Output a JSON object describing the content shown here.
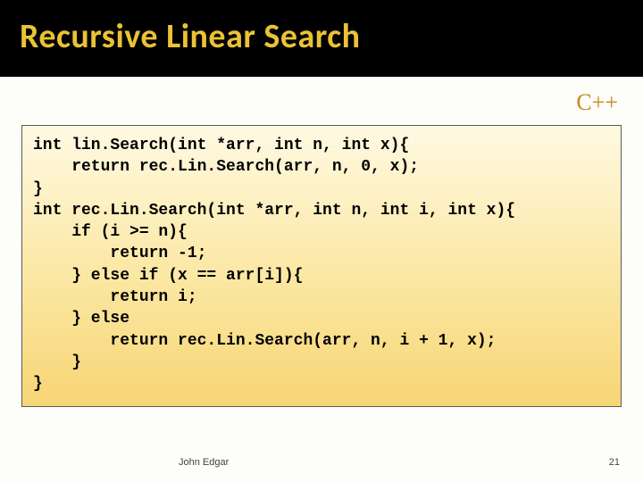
{
  "title": "Recursive Linear Search",
  "language_label": "C++",
  "code": "int lin.Search(int *arr, int n, int x){\n    return rec.Lin.Search(arr, n, 0, x);\n}\nint rec.Lin.Search(int *arr, int n, int i, int x){\n    if (i >= n){\n        return -1;\n    } else if (x == arr[i]){\n        return i;\n    } else\n        return rec.Lin.Search(arr, n, i + 1, x);\n    }\n}",
  "footer": {
    "author": "John Edgar",
    "page_number": "21"
  }
}
